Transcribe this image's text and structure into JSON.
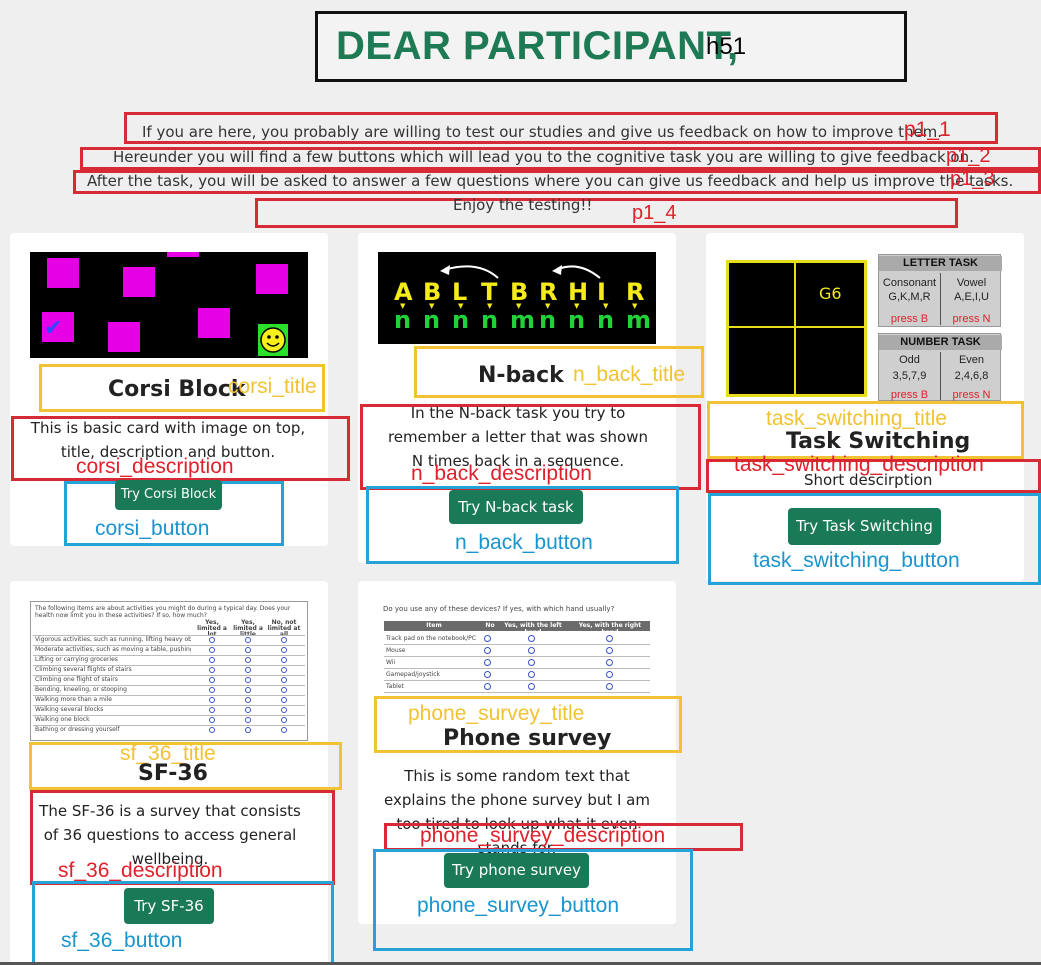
{
  "header": {
    "title": "DEAR PARTICIPANT,",
    "tag": "h51"
  },
  "intro": [
    {
      "text": "If you are here, you probably are willing to test our studies and give us feedback on how to improve them.",
      "tag": "p1_1"
    },
    {
      "text": "Hereunder you will find a few buttons which will lead you to the cognitive task you are willing to give feedback on.",
      "tag": "p1_2"
    },
    {
      "text": "After the task, you will be asked to answer a few questions where you can give us feedback and help us improve the tasks.",
      "tag": "p1_3"
    },
    {
      "text": "Enjoy the testing!!",
      "tag": "p1_4"
    }
  ],
  "cards": {
    "corsi": {
      "title": "Corsi Block",
      "title_tag": "corsi_title",
      "description": "This is basic card with image on top, title, description and button.",
      "description_tag": "corsi_description",
      "button": "Try Corsi Block",
      "button_tag": "corsi_button"
    },
    "nback": {
      "title": "N-back",
      "title_tag": "n_back_title",
      "description": "In the N-back task you try to remember a letter that was shown N times back in a sequence.",
      "description_tag": "n_back_description",
      "button": "Try N-back task",
      "button_tag": "n_back_button",
      "letters": [
        "A",
        "B",
        "L",
        "T",
        "B",
        "R",
        "H",
        "I",
        "R"
      ],
      "n_letters": [
        "n",
        "n",
        "n",
        "n",
        "m",
        "n",
        "n",
        "n",
        "m"
      ]
    },
    "task_switching": {
      "title": "Task Switching",
      "title_tag": "task_switching_title",
      "description": "Short descirption",
      "description_tag": "task_switching_description",
      "button": "Try Task Switching",
      "button_tag": "task_switching_button",
      "stim": "G6",
      "letter_task": {
        "title": "LETTER TASK",
        "left_head": "Consonant",
        "left_items": "G,K,M,R",
        "left_press": "press B",
        "right_head": "Vowel",
        "right_items": "A,E,I,U",
        "right_press": "press N"
      },
      "number_task": {
        "title": "NUMBER TASK",
        "left_head": "Odd",
        "left_items": "3,5,7,9",
        "left_press": "press B",
        "right_head": "Even",
        "right_items": "2,4,6,8",
        "right_press": "press N"
      }
    },
    "sf36": {
      "title": "SF-36",
      "title_tag": "sf_36_title",
      "description": "The SF-36 is a survey that consists of 36 questions to access general wellbeing.",
      "description_tag": "sf_36_description",
      "button": "Try SF-36",
      "button_tag": "sf_36_button",
      "img_intro": "The following items are about activities you might do during a typical day. Does your health now limit you in these activities? If so, how much?",
      "img_cols": [
        "Yes, limited a lot",
        "Yes, limited a little",
        "No, not limited at all"
      ],
      "img_rows": [
        "Vigorous activities, such as running, lifting heavy objects, participating in strenuous sports",
        "Moderate activities, such as moving a table, pushing a vacuum cleaner, bowling, or playing golf",
        "Lifting or carrying groceries",
        "Climbing several flights of stairs",
        "Climbing one flight of stairs",
        "Bending, kneeling, or stooping",
        "Walking more than a mile",
        "Walking several blocks",
        "Walking one block",
        "Bathing or dressing yourself"
      ]
    },
    "phone": {
      "title": "Phone survey",
      "title_tag": "phone_survey_title",
      "description": "This is some random text that explains the phone survey but I am too tired to look up what it even stands for.",
      "description_tag": "phone_survey_description",
      "button": "Try phone survey",
      "button_tag": "phone_survey_button",
      "img_question": "Do you use any of these devices? If yes, with which hand usually?",
      "img_cols": [
        "Item",
        "No",
        "Yes, with the left hand",
        "Yes, with the right hand"
      ],
      "img_rows": [
        "Track pad on the notebook/PC",
        "Mouse",
        "Wii",
        "Gamepad/joystick",
        "Tablet"
      ]
    }
  },
  "colors": {
    "brand_green": "#1a7a58",
    "annot_red": "#d62b35",
    "annot_yellow": "#f1c232",
    "annot_blue": "#25a3d8"
  }
}
